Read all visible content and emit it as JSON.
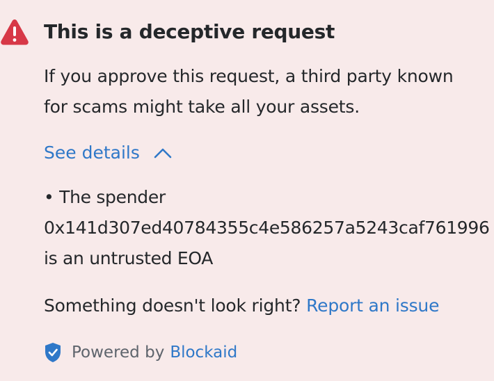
{
  "alert": {
    "icon": "warning-triangle-icon",
    "severity_color": "#d73847",
    "title": "This is a deceptive request",
    "body_line1": "If you approve this request, a third party known",
    "body_line2": "for scams might take all your assets.",
    "see_details_label": "See details",
    "details": {
      "line1": "• The spender",
      "address": "0x141d307ed40784355c4e586257a5243caf761996",
      "line3": "is an untrusted EOA"
    },
    "report_prompt": "Something doesn't look right?",
    "report_link_label": "Report an issue",
    "powered_by_label": "Powered by",
    "powered_by_brand": "Blockaid",
    "link_color": "#2f78c8",
    "background_color": "#f8eaea"
  }
}
